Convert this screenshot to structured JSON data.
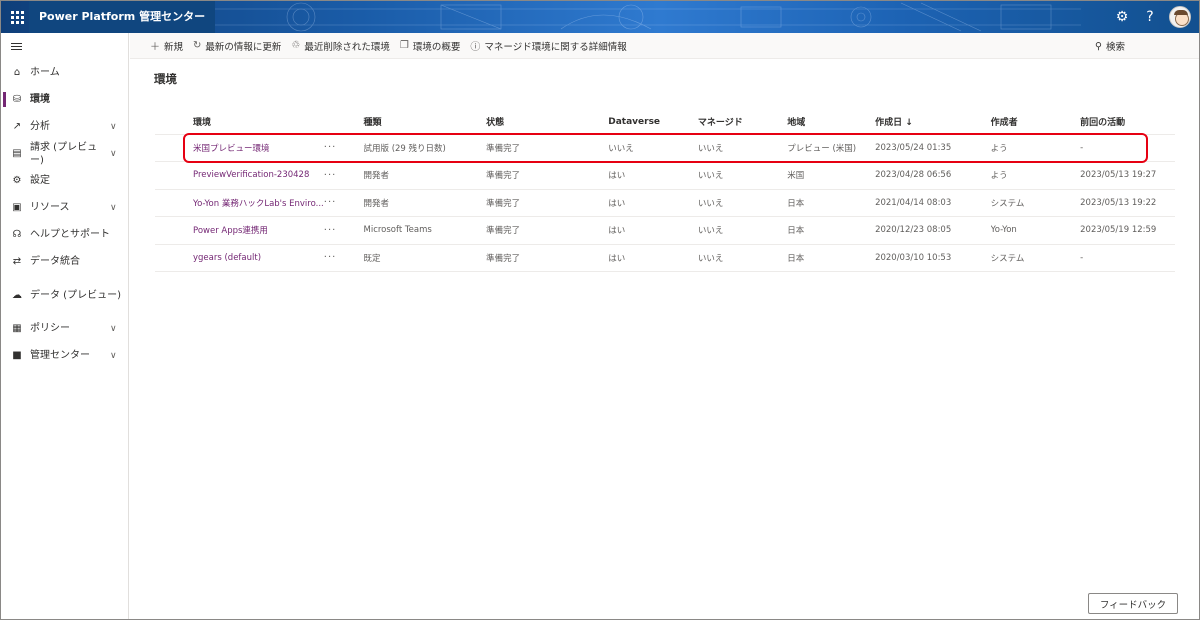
{
  "header": {
    "app_title": "Power Platform 管理センター",
    "help_label": "?"
  },
  "sidebar": {
    "items": [
      {
        "label": "ホーム",
        "icon": "home-icon",
        "has_chevron": false
      },
      {
        "label": "環境",
        "icon": "environments-icon",
        "has_chevron": false,
        "active": true
      },
      {
        "label": "分析",
        "icon": "analytics-icon",
        "has_chevron": true
      },
      {
        "label": "請求 (プレビュー)",
        "icon": "billing-icon",
        "has_chevron": true
      },
      {
        "label": "設定",
        "icon": "gear-icon",
        "has_chevron": false
      },
      {
        "label": "リソース",
        "icon": "resources-icon",
        "has_chevron": true
      },
      {
        "label": "ヘルプとサポート",
        "icon": "headset-icon",
        "has_chevron": false
      },
      {
        "label": "データ統合",
        "icon": "data-integration-icon",
        "has_chevron": false
      },
      {
        "label": "データ (プレビュー)",
        "icon": "cloud-data-icon",
        "has_chevron": false
      },
      {
        "label": "ポリシー",
        "icon": "policy-icon",
        "has_chevron": true
      },
      {
        "label": "管理センター",
        "icon": "admin-center-icon",
        "has_chevron": true
      }
    ]
  },
  "commandbar": {
    "new": "新規",
    "refresh": "最新の情報に更新",
    "recently_deleted": "最近削除された環境",
    "overview": "環境の概要",
    "managed_info": "マネージド環境に関する詳細情報",
    "search": "検索"
  },
  "main": {
    "title": "環境",
    "columns": [
      "環境",
      "",
      "種類",
      "状態",
      "Dataverse",
      "マネージド",
      "地域",
      "作成日 ↓",
      "作成者",
      "前回の活動"
    ],
    "rows": [
      {
        "name": "米国プレビュー環境",
        "more": "···",
        "type": "試用版 (29 残り日数)",
        "state": "準備完了",
        "dataverse": "いいえ",
        "managed": "いいえ",
        "region": "プレビュー (米国)",
        "created": "2023/05/24 01:35",
        "creator": "よう",
        "last": "-"
      },
      {
        "name": "PreviewVerification-230428",
        "more": "···",
        "type": "開発者",
        "state": "準備完了",
        "dataverse": "はい",
        "managed": "いいえ",
        "region": "米国",
        "created": "2023/04/28 06:56",
        "creator": "よう",
        "last": "2023/05/13 19:27"
      },
      {
        "name": "Yo-Yon 業務ハックLab's Enviro...",
        "more": "···",
        "type": "開発者",
        "state": "準備完了",
        "dataverse": "はい",
        "managed": "いいえ",
        "region": "日本",
        "created": "2021/04/14 08:03",
        "creator": "システム",
        "last": "2023/05/13 19:22"
      },
      {
        "name": "Power Apps連携用",
        "more": "···",
        "type": "Microsoft Teams",
        "state": "準備完了",
        "dataverse": "はい",
        "managed": "いいえ",
        "region": "日本",
        "created": "2020/12/23 08:05",
        "creator": "Yo-Yon",
        "last": "2023/05/19 12:59"
      },
      {
        "name": "ygears (default)",
        "more": "···",
        "type": "既定",
        "state": "準備完了",
        "dataverse": "はい",
        "managed": "いいえ",
        "region": "日本",
        "created": "2020/03/10 10:53",
        "creator": "システム",
        "last": "-"
      }
    ]
  },
  "feedback": "フィードバック",
  "colors": {
    "accent": "#742774",
    "highlight": "#e60012",
    "topbar": "#1a5ca8"
  }
}
